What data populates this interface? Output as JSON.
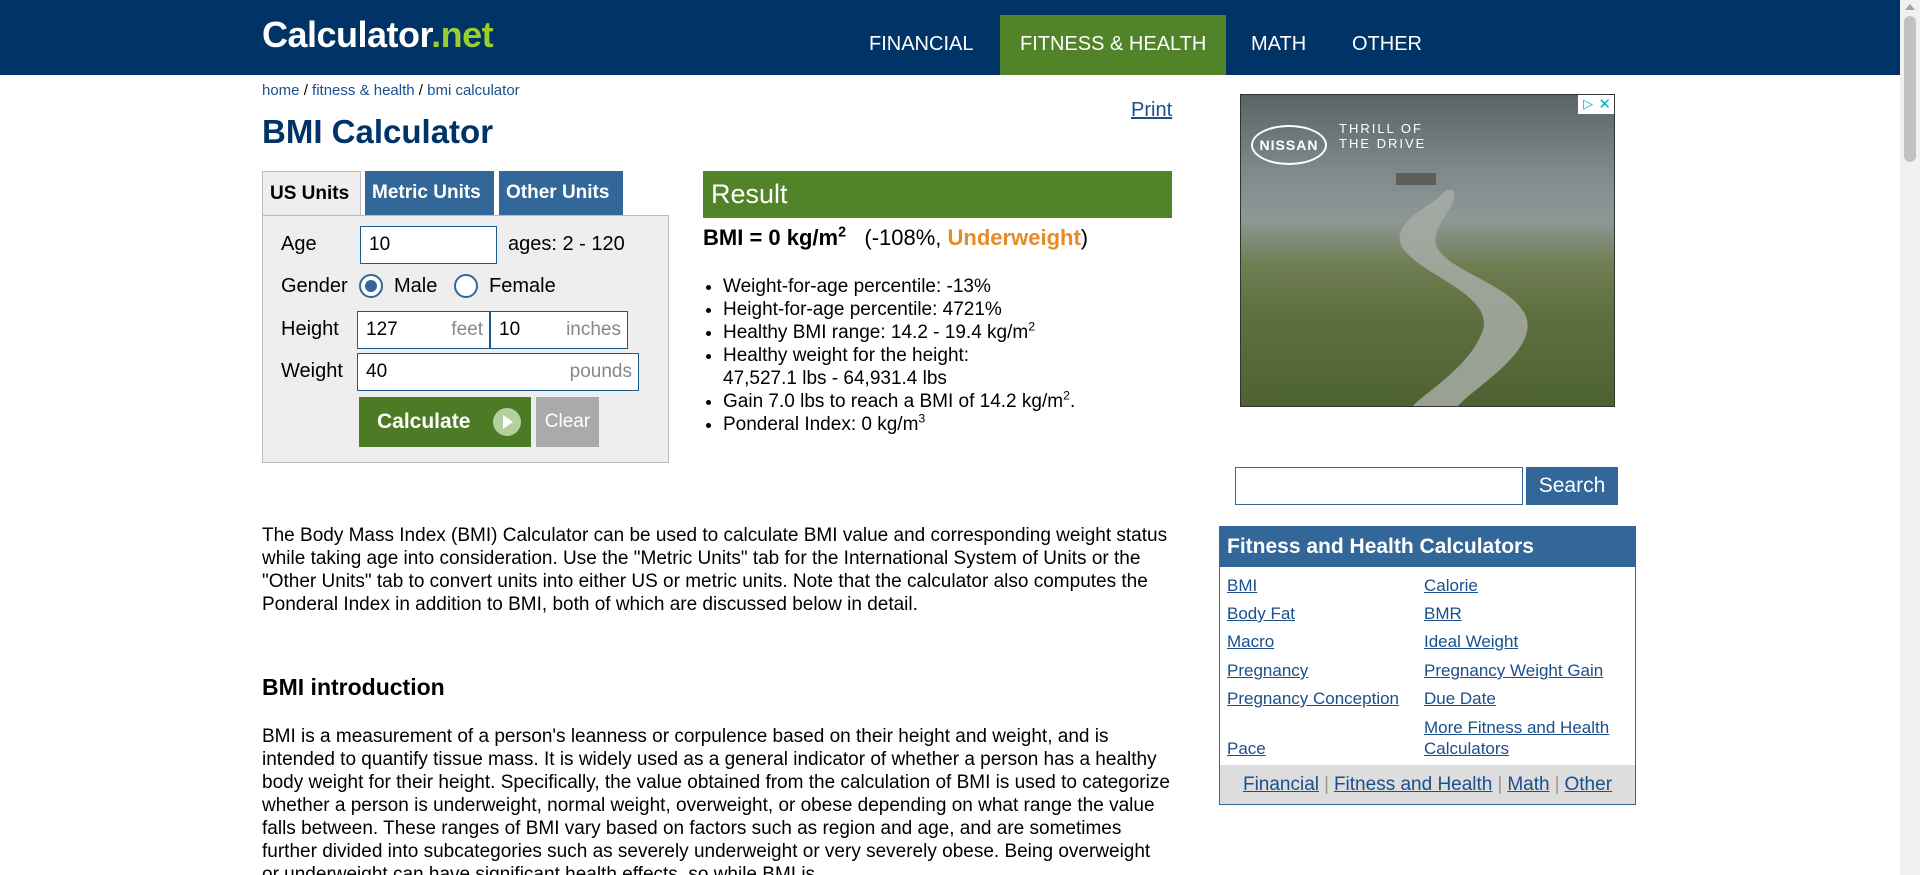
{
  "header": {
    "logo_main": "Calculator",
    "logo_dot": ".",
    "logo_tld": "net",
    "nav": [
      "FINANCIAL",
      "FITNESS & HEALTH",
      "MATH",
      "OTHER"
    ]
  },
  "breadcrumb": {
    "home": "home",
    "sep1": " / ",
    "section": "fitness & health",
    "sep2": " / ",
    "current": "bmi calculator"
  },
  "page_title": "BMI Calculator",
  "print_label": "Print",
  "tabs": [
    "US Units",
    "Metric Units",
    "Other Units"
  ],
  "form": {
    "age_label": "Age",
    "age_value": "10",
    "age_hint": "ages: 2 - 120",
    "gender_label": "Gender",
    "male_label": "Male",
    "female_label": "Female",
    "height_label": "Height",
    "height_feet_value": "127",
    "height_feet_unit": "feet",
    "height_inches_value": "10",
    "height_inches_unit": "inches",
    "weight_label": "Weight",
    "weight_value": "40",
    "weight_unit": "pounds",
    "calculate_label": "Calculate",
    "clear_label": "Clear"
  },
  "result": {
    "header": "Result",
    "bmi_text": "BMI = 0 kg/m",
    "bmi_sup": "2",
    "pct_open": "(-108%, ",
    "status": "Underweight",
    "pct_close": ")",
    "items": {
      "weight_percentile": "Weight-for-age percentile: -13%",
      "height_percentile": "Height-for-age percentile: 4721%",
      "healthy_range": "Healthy BMI range: 14.2 - 19.4 kg/m",
      "healthy_weight_1": "Healthy weight for the height:",
      "healthy_weight_2": "47,527.1 lbs - 64,931.4 lbs",
      "gain": "Gain 7.0 lbs to reach a BMI of 14.2 kg/m",
      "ponderal": "Ponderal Index: 0 kg/m",
      "sup2": "2",
      "sup3": "3",
      "period": "."
    }
  },
  "body": {
    "intro_paragraph": "The Body Mass Index (BMI) Calculator can be used to calculate BMI value and corresponding weight status while taking age into consideration. Use the \"Metric Units\" tab for the International System of Units or the \"Other Units\" tab to convert units into either US or metric units. Note that the calculator also computes the Ponderal Index in addition to BMI, both of which are discussed below in detail.",
    "section_heading": "BMI introduction",
    "section_paragraph": "BMI is a measurement of a person's leanness or corpulence based on their height and weight, and is intended to quantify tissue mass. It is widely used as a general indicator of whether a person has a healthy body weight for their height. Specifically, the value obtained from the calculation of BMI is used to categorize whether a person is underweight, normal weight, overweight, or obese depending on what range the value falls between. These ranges of BMI vary based on factors such as region and age, and are sometimes further divided into subcategories such as severely underweight or very severely obese. Being overweight or underweight can have significant health effects, so while BMI is"
  },
  "ad": {
    "brand": "NISSAN",
    "tagline_1": "THRILL OF",
    "tagline_2": "THE DRIVE"
  },
  "search": {
    "button_label": "Search",
    "value": ""
  },
  "sidebar": {
    "title": "Fitness and Health Calculators",
    "links": [
      "BMI",
      "Calorie",
      "Body Fat",
      "BMR",
      "Macro",
      "Ideal Weight",
      "Pregnancy",
      "Pregnancy Weight Gain",
      "Pregnancy Conception",
      "Due Date",
      "Pace",
      "More Fitness and Health Calculators"
    ],
    "footer": [
      "Financial",
      "Fitness and Health",
      "Math",
      "Other"
    ],
    "footer_sep": "|"
  },
  "colors": {
    "header_bg": "#003366",
    "active_nav": "#518428",
    "link": "#1a4f8b",
    "status_underweight": "#e68b27"
  }
}
